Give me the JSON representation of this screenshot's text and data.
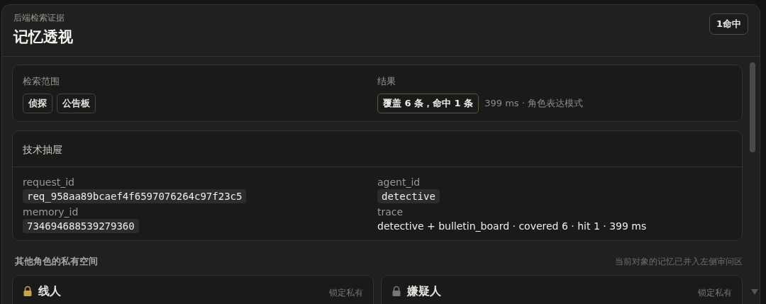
{
  "header": {
    "eyebrow": "后端检索证据",
    "title": "记忆透视",
    "badge": "1命中"
  },
  "summary": {
    "scope_label": "检索范围",
    "scopes": [
      "侦探",
      "公告板"
    ],
    "result_label": "结果",
    "result": "覆盖 6 条，命中 1 条",
    "result_note": "399 ms · 角色表达模式"
  },
  "drawer": {
    "title": "技术抽屉",
    "fields": [
      {
        "label": "request_id",
        "value": "req_958aa89bcaef4f6597076264c97f23c5",
        "kind": "code"
      },
      {
        "label": "agent_id",
        "value": "detective",
        "kind": "code"
      },
      {
        "label": "memory_id",
        "value": "734694688539279360",
        "kind": "code"
      },
      {
        "label": "trace",
        "value": "detective + bulletin_board · covered 6 · hit 1 · 399 ms",
        "kind": "text"
      }
    ]
  },
  "others": {
    "title": "其他角色的私有空间",
    "note": "当前对象的记忆已并入左侧审问区",
    "cards": [
      {
        "name": "线人",
        "status": "锁定私有"
      },
      {
        "name": "嫌疑人",
        "status": "锁定私有"
      }
    ]
  }
}
